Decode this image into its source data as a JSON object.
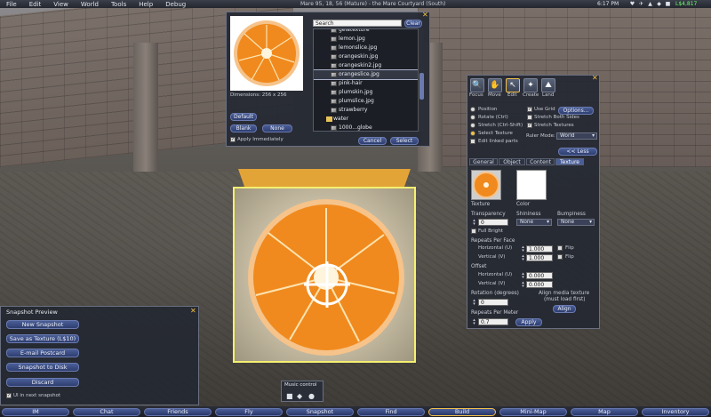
{
  "menubar": {
    "items": [
      "File",
      "Edit",
      "View",
      "World",
      "Tools",
      "Help",
      "Debug"
    ],
    "region": "Mare 95, 18, 56 (Mature) - the Mare Courtyard (South)",
    "clock": "6:17 PM",
    "balance": "L$4,817"
  },
  "picker": {
    "dimensions": "Dimensions: 256 x 256",
    "default_label": "Default",
    "blank_label": "Blank",
    "none_label": "None",
    "apply_label": "Apply Immediately",
    "apply_checked": true,
    "search_placeholder": "Search",
    "clear_label": "Clear",
    "cancel_label": "Cancel",
    "select_label": "Select",
    "items": [
      {
        "label": "gelatexture",
        "selected": false
      },
      {
        "label": "lemon.jpg",
        "selected": false
      },
      {
        "label": "lemonslice.jpg",
        "selected": false
      },
      {
        "label": "orangeskin.jpg",
        "selected": false
      },
      {
        "label": "orangeskin2.jpg",
        "selected": false
      },
      {
        "label": "orangeslice.jpg",
        "selected": true
      },
      {
        "label": "pink-hair",
        "selected": false
      },
      {
        "label": "plumskin.jpg",
        "selected": false
      },
      {
        "label": "plumslice.jpg",
        "selected": false
      },
      {
        "label": "strawberry",
        "selected": false
      },
      {
        "label": "water",
        "selected": false,
        "folder": true
      },
      {
        "label": "1000...globe",
        "selected": false
      }
    ]
  },
  "build": {
    "tools": [
      "Focus",
      "Move",
      "Edit",
      "Create",
      "Land"
    ],
    "position": "Position",
    "rotate": "Rotate (Ctrl)",
    "stretch": "Stretch (Ctrl-Shift)",
    "select_texture": "Select Texture",
    "edit_linked": "Edit linked parts",
    "use_grid": "Use Grid",
    "options": "Options...",
    "stretch_both": "Stretch Both Sides",
    "stretch_textures": "Stretch Textures",
    "ruler_mode": "Ruler Mode:",
    "ruler_value": "World",
    "less": "<< Less",
    "tabs": [
      "General",
      "Object",
      "Content",
      "Texture"
    ],
    "active_tab": "Texture",
    "texture_label": "Texture",
    "color_label": "Color",
    "transparency_label": "Transparency",
    "transparency_value": "0",
    "shininess_label": "Shininess",
    "shininess_value": "None",
    "bumpiness_label": "Bumpiness",
    "bumpiness_value": "None",
    "fullbright": "Full Bright",
    "repeats_face": "Repeats Per Face",
    "horizontal_u": "Horizontal (U)",
    "vertical_v": "Vertical (V)",
    "rep_u": "1.000",
    "rep_v": "1.000",
    "flip": "Flip",
    "offset": "Offset",
    "off_u": "0.000",
    "off_v": "0.000",
    "rotation_label": "Rotation (degrees)",
    "rotation_value": "0",
    "align_media": "Align media texture",
    "align_media_sub": "(must load first)",
    "align_btn": "Align",
    "repeats_meter": "Repeats Per Meter",
    "repeats_meter_value": "0.7",
    "apply_btn": "Apply"
  },
  "snapshot": {
    "title": "Snapshot Preview",
    "buttons": [
      "New Snapshot",
      "Save as Texture (L$10)",
      "E-mail Postcard",
      "Snapshot to Disk",
      "Discard"
    ],
    "ui_label": "UI in next snapshot",
    "ui_checked": true
  },
  "music": {
    "label": "Music control"
  },
  "toolbar": {
    "buttons": [
      "IM",
      "Chat",
      "Friends",
      "Fly",
      "Snapshot",
      "Find",
      "Build",
      "Mini-Map",
      "Map",
      "Inventory"
    ],
    "active": "Build"
  },
  "colors": {
    "accent": "#4a5e97",
    "highlight": "#f3c04a",
    "balance": "#6cff6c",
    "cube_outline": "#f4f070"
  }
}
